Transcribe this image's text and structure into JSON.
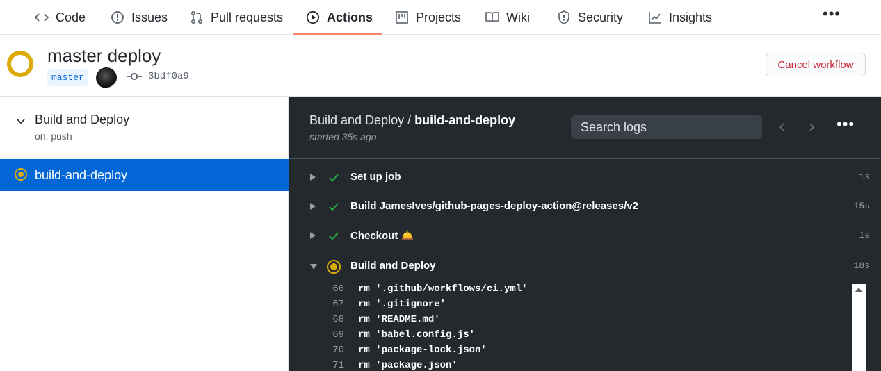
{
  "repo_nav": {
    "tabs": [
      {
        "label": "Code",
        "icon": "code-icon"
      },
      {
        "label": "Issues",
        "icon": "issue-icon"
      },
      {
        "label": "Pull requests",
        "icon": "pull-request-icon"
      },
      {
        "label": "Actions",
        "icon": "play-icon",
        "active": true
      },
      {
        "label": "Projects",
        "icon": "project-icon"
      },
      {
        "label": "Wiki",
        "icon": "book-icon"
      },
      {
        "label": "Security",
        "icon": "shield-icon"
      },
      {
        "label": "Insights",
        "icon": "graph-icon"
      }
    ],
    "more": "•••"
  },
  "workflow": {
    "title": "master deploy",
    "branch": "master",
    "commit_sha": "3bdf0a9",
    "cancel_label": "Cancel workflow",
    "status": "in_progress"
  },
  "sidebar": {
    "group_name": "Build and Deploy",
    "group_trigger": "on: push",
    "job_name": "build-and-deploy"
  },
  "log_panel": {
    "title_workflow": "Build and Deploy",
    "title_separator": " / ",
    "title_job": "build-and-deploy",
    "started": "started 35s ago",
    "search_placeholder": "Search logs",
    "more": "•••",
    "steps": [
      {
        "name": "Set up job",
        "duration": "1s",
        "status": "success"
      },
      {
        "name": "Build JamesIves/github-pages-deploy-action@releases/v2",
        "duration": "15s",
        "status": "success"
      },
      {
        "name": "Checkout 🛎️",
        "duration": "1s",
        "status": "success"
      },
      {
        "name": "Build and Deploy",
        "duration": "18s",
        "status": "in_progress"
      }
    ],
    "log_lines": [
      {
        "n": "66",
        "text": "rm '.github/workflows/ci.yml'"
      },
      {
        "n": "67",
        "text": "rm '.gitignore'"
      },
      {
        "n": "68",
        "text": "rm 'README.md'"
      },
      {
        "n": "69",
        "text": "rm 'babel.config.js'"
      },
      {
        "n": "70",
        "text": "rm 'package-lock.json'"
      },
      {
        "n": "71",
        "text": "rm 'package.json'"
      }
    ]
  },
  "colors": {
    "accent_blue": "#0366d6",
    "running_yellow": "#dbab09",
    "success_green": "#28a745",
    "danger_red": "#cb2431",
    "tab_underline": "#f9826c",
    "log_bg": "#24292e"
  }
}
